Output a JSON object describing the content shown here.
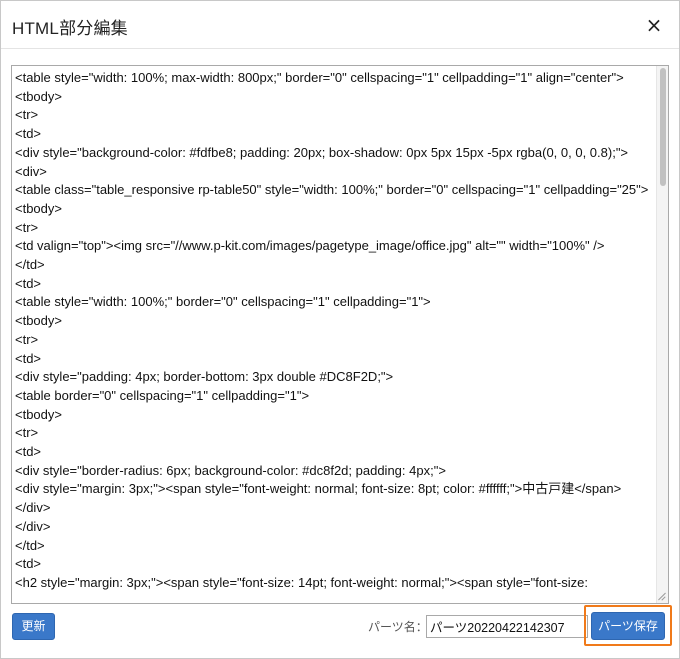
{
  "dialog": {
    "title": "HTML部分編集",
    "close_glyph": "×"
  },
  "editor": {
    "lines": [
      "<table style=\"width: 100%; max-width: 800px;\" border=\"0\" cellspacing=\"1\" cellpadding=\"1\" align=\"center\">",
      "<tbody>",
      "<tr>",
      "<td>",
      "<div style=\"background-color: #fdfbe8; padding: 20px; box-shadow: 0px 5px 15px -5px rgba(0, 0, 0, 0.8);\">",
      "<div>",
      "<table class=\"table_responsive rp-table50\" style=\"width: 100%;\" border=\"0\" cellspacing=\"1\" cellpadding=\"25\">",
      "<tbody>",
      "<tr>",
      "<td valign=\"top\"><img src=\"//www.p-kit.com/images/pagetype_image/office.jpg\" alt=\"\" width=\"100%\" />",
      "</td>",
      "<td>",
      "<table style=\"width: 100%;\" border=\"0\" cellspacing=\"1\" cellpadding=\"1\">",
      "<tbody>",
      "<tr>",
      "<td>",
      "<div style=\"padding: 4px; border-bottom: 3px double #DC8F2D;\">",
      "<table border=\"0\" cellspacing=\"1\" cellpadding=\"1\">",
      "<tbody>",
      "<tr>",
      "<td>",
      "<div style=\"border-radius: 6px; background-color: #dc8f2d; padding: 4px;\">",
      "<div style=\"margin: 3px;\"><span style=\"font-weight: normal; font-size: 8pt; color: #ffffff;\">中古戸建</span>",
      "</div>",
      "</div>",
      "</td>",
      "<td>",
      "<h2 style=\"margin: 3px;\"><span style=\"font-size: 14pt; font-weight: normal;\"><span style=\"font-size:"
    ]
  },
  "footer": {
    "update_label": "更新",
    "parts_name_label": "パーツ名：",
    "parts_name_value": "パーツ20220422142307",
    "save_label": "パーツ保存"
  },
  "colors": {
    "primary_button": "#3a78c9",
    "highlight_outline": "#f07a1a"
  }
}
